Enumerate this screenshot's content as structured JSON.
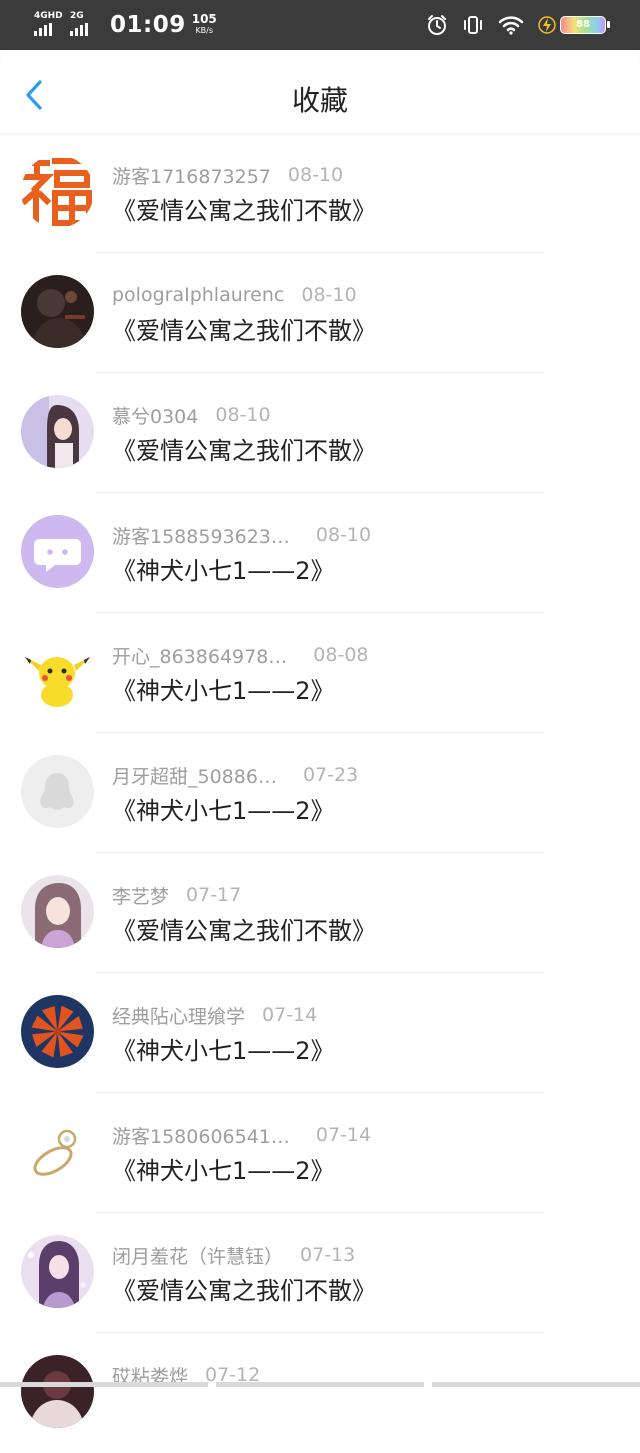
{
  "status_bar": {
    "network_1": "4GHD",
    "network_2": "2G",
    "time": "01:09",
    "speed_value": "105",
    "speed_unit": "KB/s",
    "battery_level": "88",
    "icons": [
      "alarm-icon",
      "vibrate-icon",
      "wifi-icon",
      "charging-icon",
      "battery-icon"
    ]
  },
  "header": {
    "title": "收藏",
    "back_icon": "chevron-left-icon",
    "accent_color": "#2a9cf3"
  },
  "items": [
    {
      "user": "游客1716873257",
      "date": "08-10",
      "book": "《爱情公寓之我们不散》",
      "avatar": "fu-character-avatar"
    },
    {
      "user": "polograIphlaurenc",
      "date": "08-10",
      "book": "《爱情公寓之我们不散》",
      "avatar": "dark-photo-avatar"
    },
    {
      "user": "慕兮0304",
      "date": "08-10",
      "book": "《爱情公寓之我们不散》",
      "avatar": "anime-girl-avatar"
    },
    {
      "user": "游客1588593623…",
      "date": "08-10",
      "book": "《神犬小七1——2》",
      "avatar": "chat-bubble-avatar"
    },
    {
      "user": "开心_863864978…",
      "date": "08-08",
      "book": "《神犬小七1——2》",
      "avatar": "pikachu-avatar"
    },
    {
      "user": "月牙超甜_50886…",
      "date": "07-23",
      "book": "《神犬小七1——2》",
      "avatar": "default-penguin-avatar"
    },
    {
      "user": "李艺梦",
      "date": "07-17",
      "book": "《爱情公寓之我们不散》",
      "avatar": "anime-girl-avatar"
    },
    {
      "user": "经典阽心理飨学",
      "date": "07-14",
      "book": "《神犬小七1——2》",
      "avatar": "orange-flower-avatar"
    },
    {
      "user": "游客1580606541…",
      "date": "07-14",
      "book": "《神犬小七1——2》",
      "avatar": "ring-avatar"
    },
    {
      "user": "闭月羞花（许慧钰）",
      "date": "07-13",
      "book": "《爱情公寓之我们不散》",
      "avatar": "anime-girl-avatar"
    },
    {
      "user": "砹粘娄烨",
      "date": "07-12",
      "book": "",
      "avatar": "dark-photo-avatar"
    }
  ]
}
